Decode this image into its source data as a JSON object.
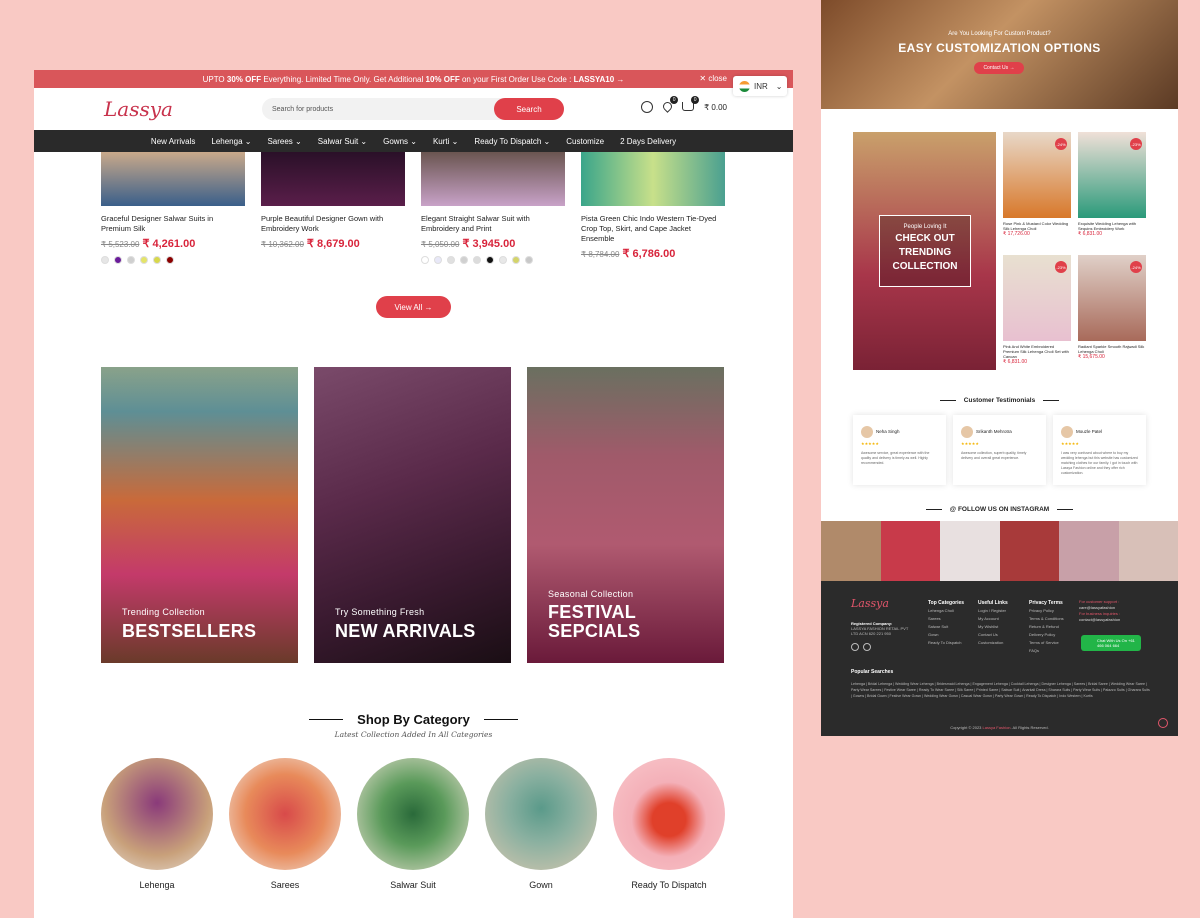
{
  "promo": {
    "pre": "UPTO ",
    "pct1": "30% OFF",
    "mid": " Everything. Limited Time Only. Get Additional ",
    "pct2": "10% OFF",
    "mid2": " on your First Order Use Code : ",
    "code": "LASSYA10",
    "arrow": " →",
    "close": "✕ close"
  },
  "currency": {
    "code": "INR",
    "chevron": "⌄"
  },
  "header": {
    "logo": "Lassya",
    "search_placeholder": "Search for products",
    "search_button": "Search",
    "wishlist_count": "0",
    "cart_count": "0",
    "cart_total": "₹ 0.00"
  },
  "nav": [
    "New Arrivals",
    "Lehenga ⌄",
    "Sarees ⌄",
    "Salwar Suit ⌄",
    "Gowns ⌄",
    "Kurti ⌄",
    "Ready To Dispatch ⌄",
    "Customize",
    "2 Days Delivery"
  ],
  "products": [
    {
      "name": "Graceful Designer Salwar Suits in Premium Silk",
      "old": "₹ 5,523.00",
      "price": "₹ 4,261.00",
      "colors": [
        "#e6e6e6",
        "#6a1b9a",
        "#cfcfcf",
        "#e4e46a",
        "#d8d84a",
        "#8b0000"
      ],
      "img": "linear-gradient(180deg,#c9a98a,#3a5f8a)"
    },
    {
      "name": "Purple Beautiful Designer Gown with Embroidery Work",
      "old": "₹ 10,362.00",
      "price": "₹ 8,679.00",
      "colors": [],
      "img": "linear-gradient(180deg,#2a1028,#5a1e4a)"
    },
    {
      "name": "Elegant Straight Salwar Suit with Embroidery and Print",
      "old": "₹ 5,050.00",
      "price": "₹ 3,945.00",
      "colors": [
        "#ffffff",
        "#e8e8f8",
        "#e0e0e0",
        "#d0d0d0",
        "#dcdcdc",
        "#111111",
        "#e8e8e8",
        "#d4d46a",
        "#c8c8c8"
      ],
      "img": "linear-gradient(180deg,#6a5550,#c8a2c8)"
    },
    {
      "name": "Pista Green Chic Indo Western Tie-Dyed Crop Top, Skirt, and Cape Jacket Ensemble",
      "old": "₹ 8,784.00",
      "price": "₹ 6,786.00",
      "colors": [],
      "img": "linear-gradient(90deg,#3aa58a,#c8e08a,#4aa090)"
    }
  ],
  "view_all": "View All →",
  "banners": [
    {
      "sub": "Trending Collection",
      "title": "BESTSELLERS",
      "img": "linear-gradient(180deg,#8aa28a 0%,#5e8f95 15%,#c96a3a 45%,#c43a6a 70%,#6a3a2a 100%)"
    },
    {
      "sub": "Try Something Fresh",
      "title": "NEW ARRIVALS",
      "img": "linear-gradient(160deg,#7a4a6a 0%,#5a2a4a 40%,#3a1a30 70%,#1a0e14 100%)"
    },
    {
      "sub": "Seasonal Collection",
      "title": "FESTIVAL SEPCIALS",
      "img": "linear-gradient(180deg,#6a7060 0%,#a05a6a 30%,#b05a70 60%,#6a1a3a 100%)"
    }
  ],
  "shop_by_category": {
    "title": "Shop By Category",
    "subtitle": "Latest Collection Added In All Categories",
    "items": [
      {
        "label": "Lehenga",
        "img": "radial-gradient(circle at 50% 40%,#8a3a7a,#c8a07a 60%,#e8e0d8)"
      },
      {
        "label": "Sarees",
        "img": "radial-gradient(circle at 50% 50%,#d84a4a,#e88a5a 50%,#f0e8e0)"
      },
      {
        "label": "Salwar Suit",
        "img": "radial-gradient(circle at 50% 50%,#2a6a3a,#5a9a5a 40%,#e8e0d0)"
      },
      {
        "label": "Gown",
        "img": "radial-gradient(circle at 50% 45%,#5a9a8a,#8ab0a0 40%,#d8c8b0)"
      },
      {
        "label": "Ready To Dispatch",
        "img": "radial-gradient(circle at 50% 55%,#e0402a 20%,#f4b0b8 45%,#f8c8cc)"
      }
    ]
  },
  "right": {
    "hero_q": "Are You Looking For Custom Product?",
    "hero_title": "EASY CUSTOMIZATION OPTIONS",
    "hero_btn": "Contact Us →",
    "trend_a": "People Loving It",
    "trend_b": "CHECK OUT TRENDING COLLECTION",
    "mini_products": [
      {
        "name": "Rose Pink & Mustard Color Wedding Silk Lehenga Choli",
        "price": "₹ 17,726.00",
        "off": "-24%",
        "img": "linear-gradient(180deg,#e8d8c8,#d8782a)"
      },
      {
        "name": "Exquisite Wedding Lehenga with Sequins Embroidery Work",
        "price": "₹ 6,831.00",
        "off": "-23%",
        "img": "linear-gradient(180deg,#f0e0d8,#2a9a7a)"
      },
      {
        "name": "Pink And White Embroidered Premium Silk Lehenga Choli Set with Cancan",
        "price": "₹ 6,831.00",
        "off": "-23%",
        "img": "linear-gradient(180deg,#e8e0d0,#e8c0d0)"
      },
      {
        "name": "Radiant Sparkle Smooth Rajwadi Silk Lehenga Choli",
        "price": "₹ 15,675.00",
        "off": "-24%",
        "img": "linear-gradient(180deg,#e0d0c8,#a86a5a)"
      }
    ],
    "testimonials_title": "Customer Testimonials",
    "testimonials": [
      {
        "name": "Neha Singh",
        "text": "Awesome service, great experience with the quality and delivery is timely as well. Highly recommended."
      },
      {
        "name": "Srikanth Mehrotra",
        "text": "Awesome collection, superb quality, timely delivery and overall great experience."
      },
      {
        "name": "Mouzle Patel",
        "text": "I was very confused about where to buy my wedding lehenga but this website has customized matching clothes for our family. I got in touch with Lassya Fashion online and they offer rich customization."
      }
    ],
    "stars": "★★★★★",
    "instagram_title": "@ FOLLOW US ON INSTAGRAM",
    "instagram": [
      "#b08a6a",
      "#c83a4a",
      "#e8e0e0",
      "#a83a3a",
      "#c8a0a8",
      "#d8c0b8"
    ],
    "footer": {
      "logo": "Lassya",
      "reg_label": "Registered Company:",
      "reg_text": "LASSYA FASHION RETAIL PVT LTD ACN 620 221 950",
      "cols": [
        {
          "h": "Top Categories",
          "items": [
            "Lehenga Choli",
            "Sarees",
            "Salwar Suit",
            "Gown",
            "Ready To Dispatch"
          ]
        },
        {
          "h": "Useful Links",
          "items": [
            "Login / Register",
            "My Account",
            "My Wishlist",
            "Contact Us",
            "Customization"
          ]
        },
        {
          "h": "Privacy Terms",
          "items": [
            "Privacy Policy",
            "Terms & Conditions",
            "Return & Refund",
            "Delivery Policy",
            "Terms of Service",
            "FAQs"
          ]
        }
      ],
      "support_label": "For customer support :",
      "support_mail": "care@lassyafashion",
      "biz_label": "For business inquiries :",
      "biz_mail": "contact@lassyafashion",
      "whatsapp": "Chat With Us On +61 466 064 664",
      "popular": "Popular Searches",
      "tags": "Lehenga | Bridal Lehenga | Wedding Wear Lehenga | Bridesmaid Lehenga | Engagement Lehenga | Cocktail Lehenga | Designer Lehenga | Sarees | Bridal Saree | Wedding Wear Saree | Party Wear Sarees | Festive Wear Saree | Ready To Wear Saree | Silk Saree | Printed Saree | Salwar Suit | Anarkali Dress | Sharara Suits | Party Wear Suits | Palazzo Suits | Gharara Suits | Gowns | Bridal Gown | Festive Wear Gown | Wedding Wear Gown | Casual Wear Gown | Party Wear Gown | Ready To Dispatch | Indo Western | Kurtis",
      "copyright": "Copyright © 2023 ",
      "copyright_link": "Lassya Fashion",
      "copyright_end": ". All Rights Reserved."
    }
  }
}
